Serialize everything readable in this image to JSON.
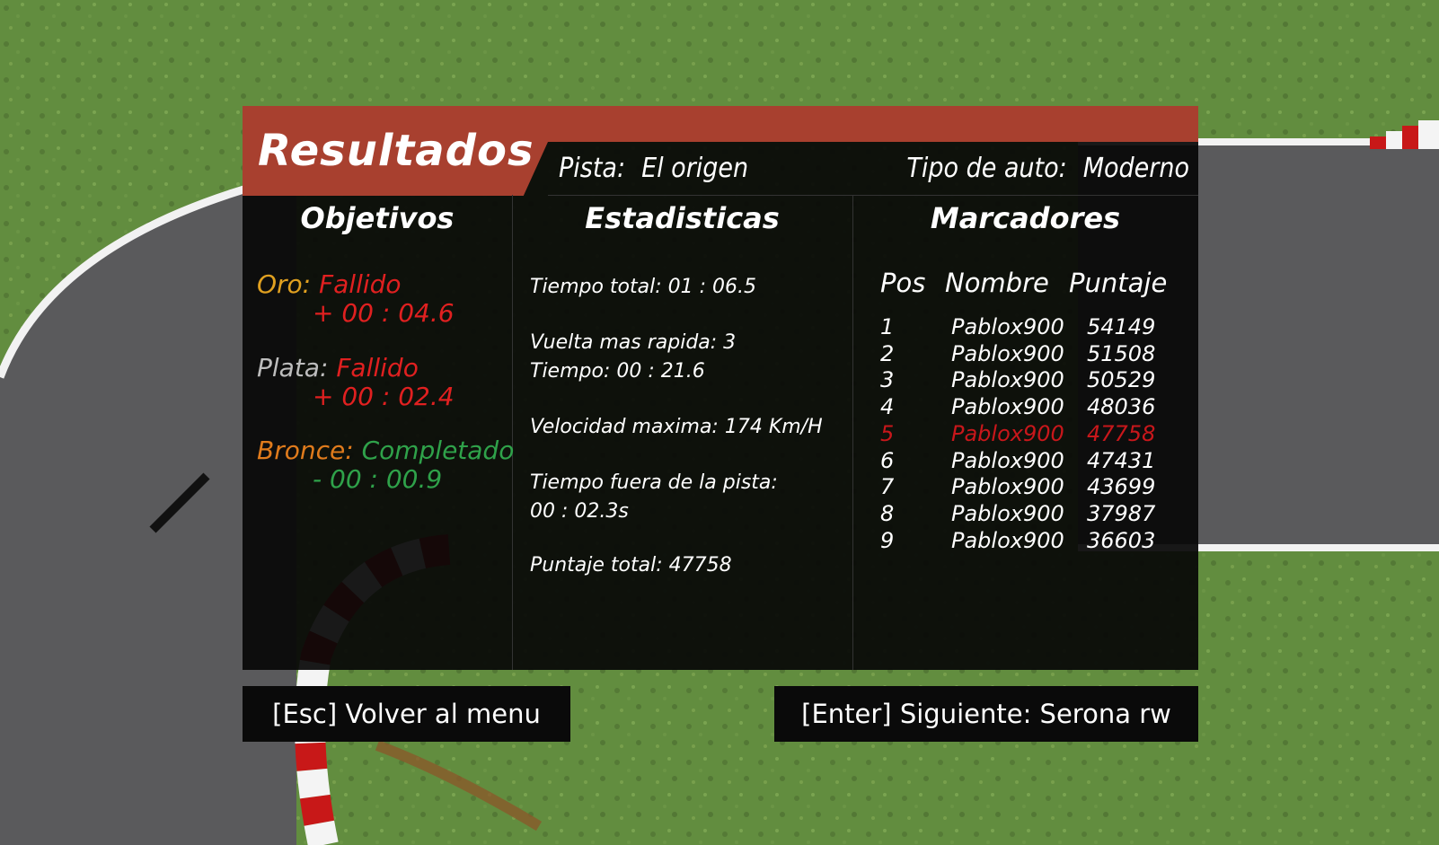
{
  "colors": {
    "accent": "#a8402f",
    "gold": "#e0a020",
    "silver": "#bdbdbd",
    "bronze": "#e07b1c",
    "failed": "#e02020",
    "completed": "#2fa24a",
    "highlight": "#c8171b"
  },
  "header": {
    "title": "Resultados",
    "track_label": "Pista:",
    "track_value": "El origen",
    "car_label": "Tipo de auto:",
    "car_value": "Moderno"
  },
  "objectives": {
    "heading": "Objetivos",
    "items": [
      {
        "medal": "Oro:",
        "status": "Fallido",
        "delta": "+ 00 : 04.6"
      },
      {
        "medal": "Plata:",
        "status": "Fallido",
        "delta": "+ 00 : 02.4"
      },
      {
        "medal": "Bronce:",
        "status": "Completado",
        "delta": "- 00 : 00.9"
      }
    ]
  },
  "stats": {
    "heading": "Estadisticas",
    "total_time": "Tiempo total:  01 : 06.5",
    "fastest_lap": "Vuelta mas rapida:  3",
    "fastest_lap_time": "Tiempo:  00 : 21.6",
    "max_speed": "Velocidad maxima:  174 Km/H",
    "offtrack_label": "Tiempo fuera de la pista:",
    "offtrack_value": "00 : 02.3s",
    "total_score": "Puntaje total:  47758"
  },
  "scoreboard": {
    "heading": "Marcadores",
    "columns": [
      "Pos",
      "Nombre",
      "Puntaje"
    ],
    "rows": [
      {
        "pos": "1",
        "name": "Pablox900",
        "score": "54149"
      },
      {
        "pos": "2",
        "name": "Pablox900",
        "score": "51508"
      },
      {
        "pos": "3",
        "name": "Pablox900",
        "score": "50529"
      },
      {
        "pos": "4",
        "name": "Pablox900",
        "score": "48036"
      },
      {
        "pos": "5",
        "name": "Pablox900",
        "score": "47758"
      },
      {
        "pos": "6",
        "name": "Pablox900",
        "score": "47431"
      },
      {
        "pos": "7",
        "name": "Pablox900",
        "score": "43699"
      },
      {
        "pos": "8",
        "name": "Pablox900",
        "score": "37987"
      },
      {
        "pos": "9",
        "name": "Pablox900",
        "score": "36603"
      }
    ],
    "highlight_pos": "5"
  },
  "buttons": {
    "back": "[Esc] Volver al menu",
    "next": "[Enter] Siguiente: Serona rw"
  }
}
